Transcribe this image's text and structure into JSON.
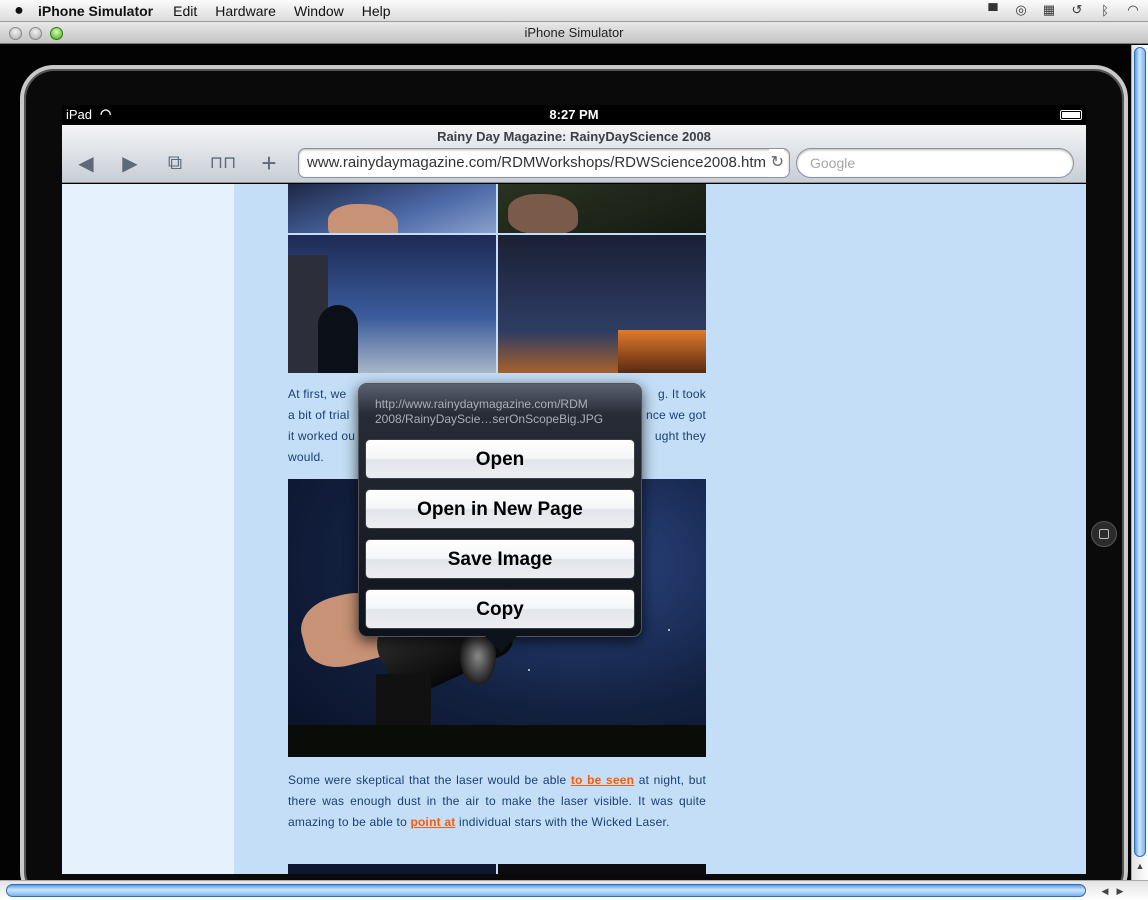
{
  "menubar": {
    "app_name": "iPhone Simulator",
    "items": [
      "Edit",
      "Hardware",
      "Window",
      "Help"
    ],
    "status_icons": [
      "top-hat-icon",
      "update-icon",
      "spaces-icon",
      "time-machine-icon",
      "bluetooth-icon",
      "wifi-icon"
    ]
  },
  "window": {
    "title": "iPhone Simulator"
  },
  "ipad_status": {
    "carrier": "iPad",
    "time": "8:27 PM"
  },
  "safari": {
    "page_title": "Rainy Day Magazine: RainyDayScience 2008",
    "url": "www.rainydaymagazine.com/RDMWorkshops/RDWScience2008.htm",
    "search_placeholder": "Google",
    "buttons": {
      "back": "◀",
      "forward": "▶",
      "pages": "⧉",
      "bookmarks": "📖",
      "add": "+"
    }
  },
  "article": {
    "para1_visible": [
      {
        "text": "At first, we",
        "left": true
      },
      {
        "text": "g.  It took"
      },
      {
        "text": "a bit of trial"
      },
      {
        "text": "nce we got"
      },
      {
        "text": "it worked ou"
      },
      {
        "text": "ught they"
      },
      {
        "text": "would."
      }
    ],
    "para2": {
      "part1": "Some were skeptical that the laser would be able ",
      "link1": "to be seen",
      "part2": " at night, but there was enough dust in the air to make the laser visible.  It was quite amazing to be able to ",
      "link2": "point at",
      "part3": " individual stars with the Wicked Laser."
    }
  },
  "context_menu": {
    "url_line1": "http://www.rainydaymagazine.com/RDM",
    "url_line2": "2008/RainyDayScie…serOnScopeBig.JPG",
    "options": [
      "Open",
      "Open in New Page",
      "Save Image",
      "Copy"
    ]
  },
  "colors": {
    "page_bg": "#c3def6",
    "link": "#ff5a00",
    "text": "#1c3f73"
  }
}
